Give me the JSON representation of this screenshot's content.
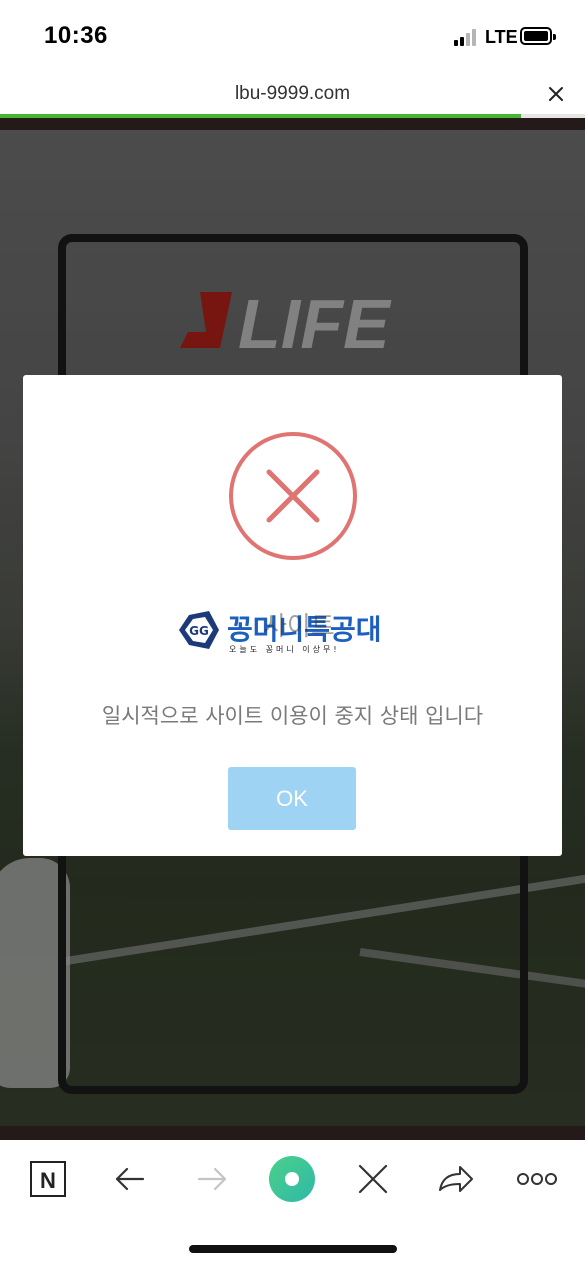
{
  "status_bar": {
    "time": "10:36",
    "network": "LTE"
  },
  "browser": {
    "url": "lbu-9999.com",
    "progress": 0.89
  },
  "background_page": {
    "logo_text": "LIFE"
  },
  "modal": {
    "icon": "error-x-circle-icon",
    "icon_color": "#e07472",
    "brand_logo_text": "꽁머니특공대",
    "brand_logo_overlap_text": "사이트",
    "brand_logo_tagline": "오늘도 꽁머니 이상무!",
    "message": "일시적으로 사이트 이용이 중지 상태 입니다",
    "ok_label": "OK",
    "ok_color": "#9fd3f3"
  },
  "toolbar": {
    "items": [
      "naver-n-icon",
      "back-arrow-icon",
      "forward-arrow-icon",
      "home-circle-icon",
      "close-icon",
      "share-icon",
      "more-icon"
    ],
    "n_label": "N",
    "accent": "#4bd08a"
  }
}
